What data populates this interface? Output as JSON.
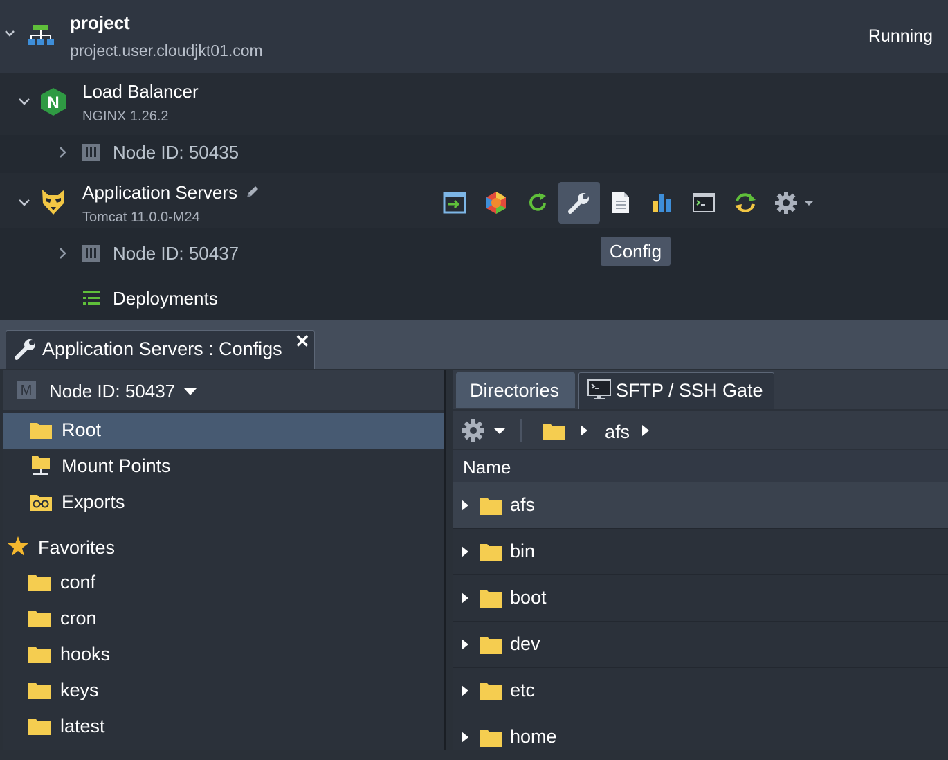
{
  "environment": {
    "name": "project",
    "domain": "project.user.cloudjkt01.com",
    "status": "Running"
  },
  "load_balancer": {
    "title": "Load Balancer",
    "subtitle": "NGINX 1.26.2",
    "node_label": "Node ID: 50435"
  },
  "app_servers": {
    "title": "Application Servers",
    "subtitle": "Tomcat 11.0.0-M24",
    "node_label": "Node ID: 50437",
    "deployments_label": "Deployments"
  },
  "toolbar": {
    "tooltip": "Config",
    "icons": [
      "open-in-browser-icon",
      "add-ons-icon",
      "restart-icon",
      "config-wrench-icon",
      "log-icon",
      "statistics-icon",
      "web-ssh-icon",
      "redeploy-icon",
      "settings-icon"
    ]
  },
  "panel": {
    "tab_title": "Application Servers : Configs",
    "close_glyph": "✕",
    "node_select": "Node ID: 50437",
    "node_badge": "M",
    "tree": [
      {
        "label": "Root",
        "icon": "folder-icon",
        "selected": true
      },
      {
        "label": "Mount Points",
        "icon": "mount-folder-icon"
      },
      {
        "label": "Exports",
        "icon": "export-folder-icon"
      }
    ],
    "favorites_label": "Favorites",
    "favorites": [
      "conf",
      "cron",
      "hooks",
      "keys",
      "latest"
    ],
    "tabs": {
      "directories": "Directories",
      "sftp": "SFTP / SSH Gate"
    },
    "path": [
      "afs"
    ],
    "name_header": "Name",
    "directories": [
      "afs",
      "bin",
      "boot",
      "dev",
      "etc",
      "home"
    ]
  },
  "colors": {
    "folder": "#f5cd50",
    "accent_selected": "#475a72",
    "background": "#232931"
  }
}
